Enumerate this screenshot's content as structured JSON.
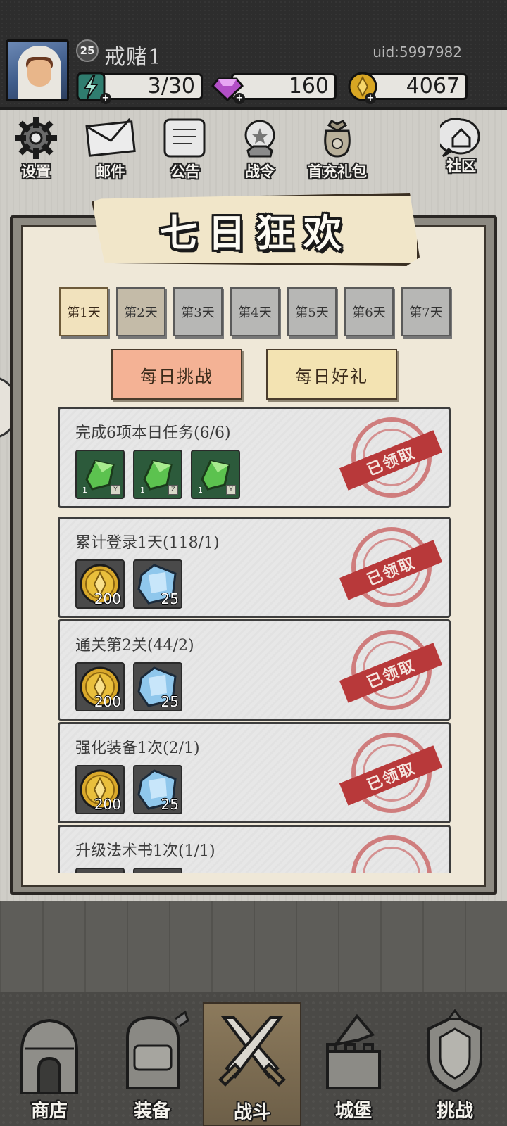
{
  "header": {
    "level": "25",
    "player_name": "戒赌1",
    "uid": "uid:5997982",
    "resources": {
      "energy": "3/30",
      "gems": "160",
      "coins": "4067"
    }
  },
  "menu": {
    "settings": "设置",
    "mail": "邮件",
    "notice": "公告",
    "battle_pass": "战令",
    "first_recharge": "首充礼包",
    "community": "社区"
  },
  "panel": {
    "title": "七日狂欢",
    "days": [
      "第1天",
      "第2天",
      "第3天",
      "第4天",
      "第5天",
      "第6天",
      "第7天"
    ],
    "subtabs": {
      "daily_challenge": "每日挑战",
      "daily_gift": "每日好礼"
    },
    "claimed_label": "已领取",
    "tasks": [
      {
        "name": "完成6项本日任务(6/6)",
        "rewards": [
          {
            "icon": "green-crystal-icon",
            "count": "1"
          },
          {
            "icon": "green-crystal-icon",
            "count": "1"
          },
          {
            "icon": "green-crystal-icon",
            "count": "1"
          }
        ]
      },
      {
        "name": "累计登录1天(118/1)",
        "rewards": [
          {
            "icon": "gold-coin-icon",
            "count": "200"
          },
          {
            "icon": "blue-crystal-icon",
            "count": "25"
          }
        ]
      },
      {
        "name": "通关第2关(44/2)",
        "rewards": [
          {
            "icon": "gold-coin-icon",
            "count": "200"
          },
          {
            "icon": "blue-crystal-icon",
            "count": "25"
          }
        ]
      },
      {
        "name": "强化装备1次(2/1)",
        "rewards": [
          {
            "icon": "gold-coin-icon",
            "count": "200"
          },
          {
            "icon": "blue-crystal-icon",
            "count": "25"
          }
        ]
      },
      {
        "name": "升级法术书1次(1/1)",
        "rewards": []
      }
    ]
  },
  "nav": {
    "shop": "商店",
    "equipment": "装备",
    "battle": "战斗",
    "castle": "城堡",
    "challenge": "挑战"
  },
  "colors": {
    "active_subtab": "#f4b295",
    "inactive_subtab": "#f3e3b2",
    "stamp_red": "#b8393a"
  }
}
